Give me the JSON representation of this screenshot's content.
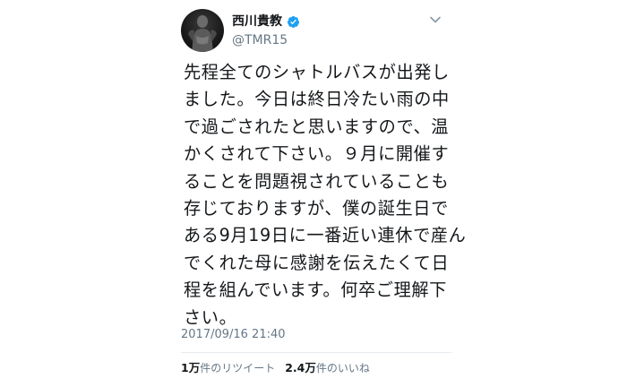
{
  "author": {
    "display_name": "西川貴教",
    "handle": "@TMR15",
    "verified": true,
    "avatar_icon": "profile-photo",
    "verified_icon": "verified-badge-icon",
    "menu_icon": "chevron-down-icon"
  },
  "tweet": {
    "lines": [
      "先程全てのシャトルバスが出発し",
      "ました。今日は終日冷たい雨の中",
      "で過ごされたと思いますので、温",
      "かくされて下さい。９月に開催す",
      "ることを問題視されていることも",
      "存じておりますが、僕の誕生日で",
      "ある9月19日に一番近い連休で産ん",
      "でくれた母に感謝を伝えたくて日",
      "程を組んでいます。何卒ご理解下",
      "さい。"
    ],
    "timestamp": "2017/09/16 21:40"
  },
  "stats": {
    "retweets_count": "1万",
    "retweets_label": "件のリツイート",
    "likes_count": "2.4万",
    "likes_label": "件のいいね"
  },
  "colors": {
    "text": "#14171a",
    "secondary": "#657786",
    "verified": "#1da1f2",
    "divider": "#e6ecf0"
  }
}
